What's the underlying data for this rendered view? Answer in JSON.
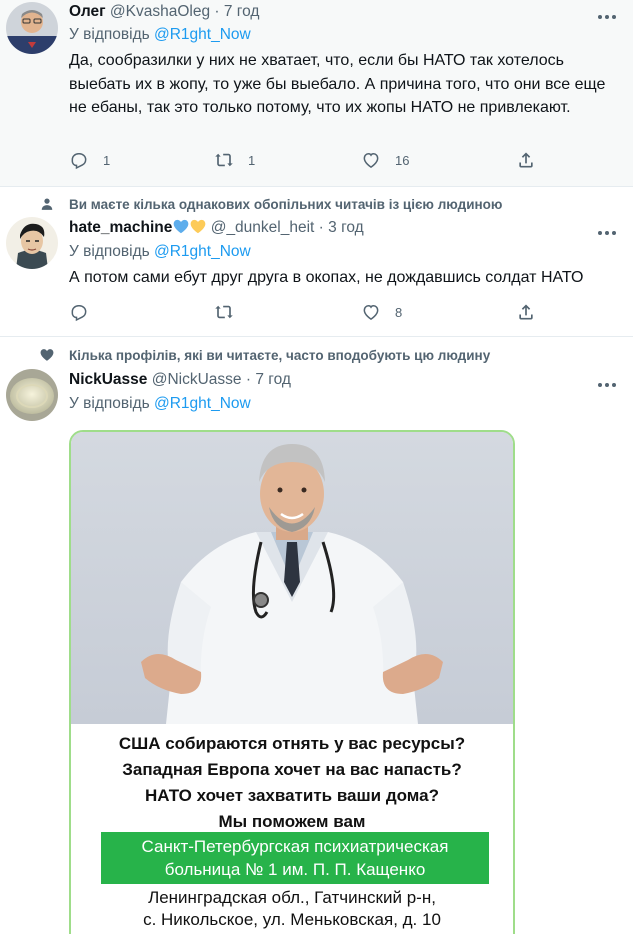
{
  "tweets": [
    {
      "name": "Олег",
      "handle": "@KvashaOleg",
      "time": "· 7 год",
      "reply_prefix": "У відповідь",
      "reply_to": "@R1ght_Now",
      "text": "Да, сообразилки у них не хватает, что, если бы НАТО так хотелось выебать их в жопу, то уже бы выебало. А причина того, что они все еще не ебаны, так это только потому, что их жопы НАТО не привлекают.",
      "replies": "1",
      "retweets": "1",
      "likes": "16"
    },
    {
      "social_context": "Ви маєте кілька однакових обопільних читачів із цією людиною",
      "name": "hate_machine",
      "handle": "@_dunkel_heit",
      "time": "· 3 год",
      "reply_prefix": "У відповідь",
      "reply_to": "@R1ght_Now",
      "text": "А потом сами ебут друг друга в окопах, не дождавшись солдат НАТО",
      "replies": "",
      "retweets": "",
      "likes": "8"
    },
    {
      "social_context": "Кілька профілів, які ви читаєте, часто вподобують цю людину",
      "name": "NickUasse",
      "handle": "@NickUasse",
      "time": "· 7 год",
      "reply_prefix": "У відповідь",
      "reply_to": "@R1ght_Now"
    }
  ],
  "ad": {
    "line1": "США собираются отнять у вас ресурсы?",
    "line2": "Западная Европа хочет на вас напасть?",
    "line3": "НАТО хочет захватить ваши дома?",
    "line4": "Мы поможем вам",
    "green_line1": "Санкт-Петербургская психиатрическая",
    "green_line2": "больница № 1 им. П. П. Кащенко",
    "addr1": "Ленинградская обл., Гатчинский р-н,",
    "addr2": "с. Никольское, ул. Меньковская, д. 10"
  },
  "icons": {
    "reply": "reply-icon",
    "retweet": "retweet-icon",
    "like": "like-icon",
    "share": "share-icon",
    "more": "more-icon"
  },
  "colors": {
    "link": "#1d9bf0",
    "secondary": "#536471",
    "green": "#27b34a"
  }
}
